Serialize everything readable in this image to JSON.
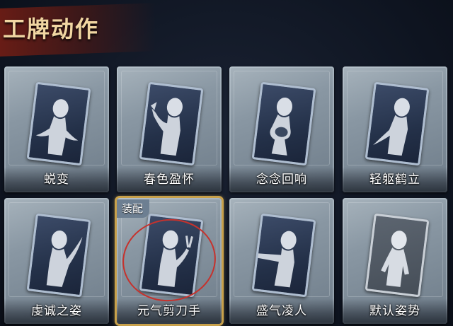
{
  "header": {
    "title": "工牌动作"
  },
  "cards": [
    {
      "label": "蜕变"
    },
    {
      "label": "春色盈怀"
    },
    {
      "label": "念念回响"
    },
    {
      "label": "轻躯鹤立"
    },
    {
      "label": "虔诚之姿"
    },
    {
      "label": "元气剪刀手",
      "tag": "装配",
      "selected": true
    },
    {
      "label": "盛气凌人"
    },
    {
      "label": "默认姿势"
    }
  ],
  "colors": {
    "title": "#f1d6a2",
    "selected_border": "#c8a14b",
    "annotation_circle": "#c6322d"
  }
}
